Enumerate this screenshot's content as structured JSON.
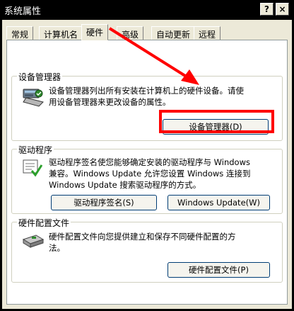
{
  "window": {
    "title": "系统属性",
    "help_label": "?",
    "close_label": "×"
  },
  "tabs": [
    {
      "label": "常规"
    },
    {
      "label": "计算机名"
    },
    {
      "label": "硬件"
    },
    {
      "label": "高级"
    },
    {
      "label": "自动更新"
    },
    {
      "label": "远程"
    }
  ],
  "active_tab": "硬件",
  "device_manager": {
    "group_title": "设备管理器",
    "line1": "设备管理器列出所有安装在计算机上的硬件设备。请使",
    "line2": "用设备管理器来更改设备的属性。",
    "button_label": "设备管理器(D)"
  },
  "drivers": {
    "group_title": "驱动程序",
    "line1": "驱动程序签名使您能够确定安装的驱动程序与 Windows",
    "line2": "兼容。Windows Update 允许您设置 Windows 连接到",
    "line3": "Windows Update 搜索驱动程序的方式。",
    "signing_button": "驱动程序签名(S)",
    "update_button": "Windows Update(W)"
  },
  "hardware_profiles": {
    "group_title": "硬件配置文件",
    "line1": "硬件配置文件向您提供建立和保存不同硬件配置的方",
    "line2": "法。",
    "button_label": "硬件配置文件(P)"
  },
  "colors": {
    "annotation": "#ff0000",
    "dialog_bg": "#ece9d8",
    "title_bg": "#000000"
  },
  "icons": [
    "device-manager-icon",
    "driver-signing-icon",
    "hardware-profile-icon",
    "help-icon",
    "close-icon"
  ]
}
